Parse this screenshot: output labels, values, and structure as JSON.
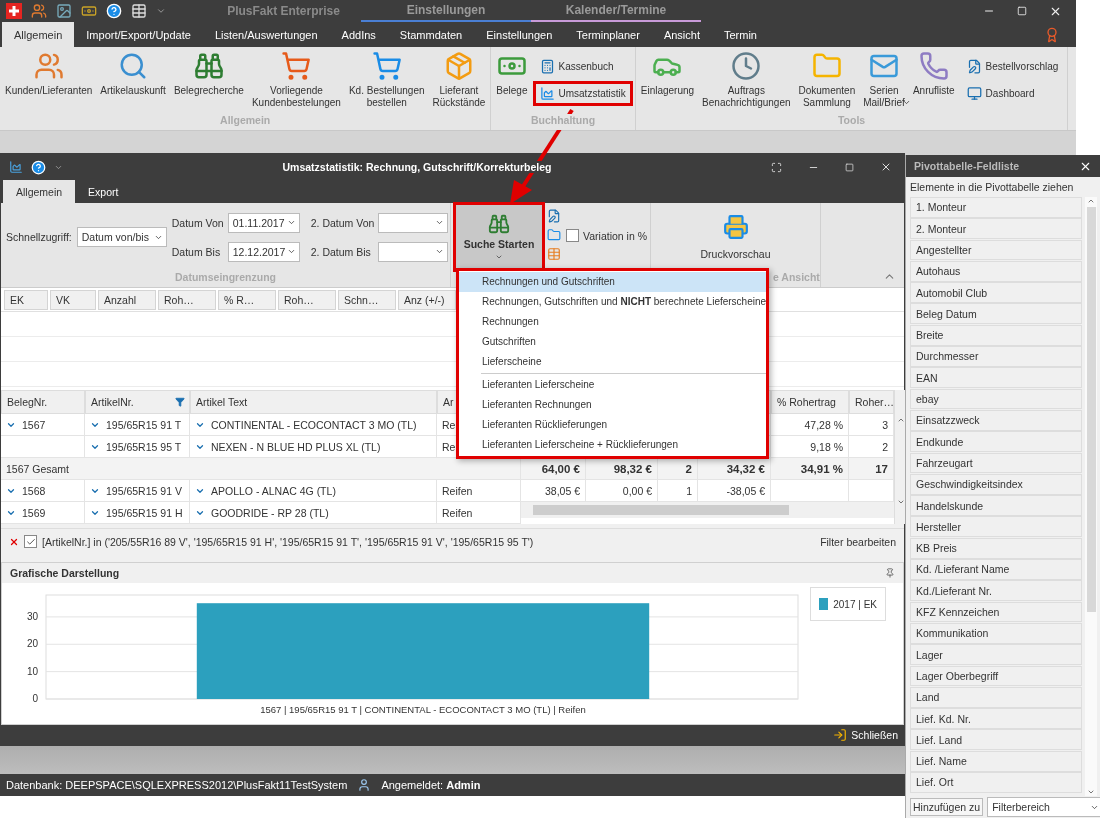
{
  "title_bar": {
    "app_title": "PlusFakt Enterprise",
    "context_tabs": [
      {
        "label": "Einstellungen",
        "color": "#4a7fd4"
      },
      {
        "label": "Kalender/Termine",
        "color": "#c89ad8"
      }
    ]
  },
  "tabs": [
    {
      "label": "Allgemein",
      "selected": true
    },
    {
      "label": "Import/Export/Update",
      "selected": false
    },
    {
      "label": "Listen/Auswertungen",
      "selected": false
    },
    {
      "label": "AddIns",
      "selected": false
    },
    {
      "label": "Stammdaten",
      "selected": false
    },
    {
      "label": "Einstellungen",
      "selected": false
    },
    {
      "label": "Terminplaner",
      "selected": false
    },
    {
      "label": "Ansicht",
      "selected": false
    },
    {
      "label": "Termin",
      "selected": false
    }
  ],
  "ribbon_groups": [
    {
      "label": "Allgemein",
      "buttons": [
        {
          "label": "Kunden/Lieferanten",
          "kind": "large",
          "highlighted": false
        },
        {
          "label": "Artikelauskunft",
          "kind": "large",
          "highlighted": false
        },
        {
          "label": "Belegrecherche",
          "kind": "large",
          "highlighted": false
        },
        {
          "label": "Vorliegende\nKundenbestelungen",
          "kind": "large",
          "highlighted": false
        },
        {
          "label": "Kd. Bestellungen\nbestellen",
          "kind": "large",
          "highlighted": false
        },
        {
          "label": "Lieferant\nRückstände",
          "kind": "large",
          "highlighted": false
        }
      ]
    },
    {
      "label": "Buchhaltung",
      "buttons": [
        {
          "label": "Belege",
          "kind": "large",
          "highlighted": false
        },
        {
          "label": "Kassenbuch",
          "kind": "small",
          "highlighted": false
        },
        {
          "label": "Umsatzstatistik",
          "kind": "small",
          "highlighted": true
        }
      ]
    },
    {
      "label": "Tools",
      "buttons": [
        {
          "label": "Einlagerung",
          "kind": "large",
          "highlighted": false
        },
        {
          "label": "Auftrags\nBenachrichtigungen",
          "kind": "large",
          "highlighted": false
        },
        {
          "label": "Dokumenten\nSammlung",
          "kind": "large",
          "highlighted": false
        },
        {
          "label": "Serien\nMail/Brief",
          "kind": "dropdown",
          "highlighted": false
        },
        {
          "label": "Anrufliste",
          "kind": "large",
          "highlighted": false
        },
        {
          "label": "Bestellvorschlag",
          "kind": "small",
          "highlighted": false
        },
        {
          "label": "Dashboard",
          "kind": "small",
          "highlighted": false
        }
      ]
    }
  ],
  "inner_window": {
    "title": "Umsatzstatistik: Rechnung, Gutschrift/Korrekturbeleg",
    "tabs": [
      {
        "label": "Allgemein",
        "selected": true
      },
      {
        "label": "Export",
        "selected": false
      }
    ],
    "quick_access": {
      "label": "Schnellzugriff:",
      "value": "Datum von/bis"
    },
    "date_fields": [
      {
        "label": "Datum Von",
        "value": "01.11.2017"
      },
      {
        "label": "Datum Bis",
        "value": "12.12.2017"
      },
      {
        "label": "2. Datum Von"
      },
      {
        "label": "2. Datum Bis"
      }
    ],
    "date_group_label": "Datumseingrenzung",
    "search_button": {
      "label": "Suche Starten",
      "highlighted": true
    },
    "variation": {
      "label": "Variation in %",
      "checked": false
    },
    "print_button": {
      "label": "Druckvorschau"
    },
    "view_group_label": "e Ansicht",
    "data_fields": [
      "EK",
      "VK",
      "Anzahl",
      "Roh…",
      "% R…",
      "Roh…",
      "Schn…",
      "Anz (+/-)"
    ],
    "row_headers": [
      "BelegNr.",
      "ArtikelNr.",
      "Artikel Text",
      "Ar"
    ],
    "value_headers": [
      "% Rohertrag",
      "Roher…"
    ],
    "rows": [
      {
        "kind": "item",
        "expanded": true,
        "cells": [
          "1567",
          "195/65R15 91 T",
          "CONTINENTAL - ECOCONTACT 3 MO (TL)",
          "Re",
          null,
          null,
          null,
          null,
          "47,28 %",
          "3"
        ]
      },
      {
        "kind": "item",
        "expanded": true,
        "cells": [
          null,
          "195/65R15 95 T",
          "NEXEN - N BLUE HD PLUS XL (TL)",
          "Re",
          null,
          null,
          null,
          null,
          "9,18 %",
          "2"
        ]
      },
      {
        "kind": "total",
        "cells": [
          "1567 Gesamt",
          null,
          null,
          null,
          "64,00 €",
          "98,32 €",
          "2",
          "34,32 €",
          "34,91 %",
          "17"
        ]
      },
      {
        "kind": "item",
        "expanded": true,
        "cells": [
          "1568",
          "195/65R15 91 V",
          "APOLLO - ALNAC 4G (TL)",
          "Reifen",
          "38,05 €",
          "0,00 €",
          "1",
          "-38,05 €",
          null,
          null
        ]
      },
      {
        "kind": "partial",
        "expanded": true,
        "cells": [
          "1569",
          "195/65R15 91 H",
          "GOODRIDE - RP 28 (TL)",
          "Reifen"
        ]
      }
    ],
    "filter": {
      "checked": true,
      "text": "[ArtikelNr.] in ('205/55R16 89 V', '195/65R15 91 H', '195/65R15 91 T', '195/65R15 91 V', '195/65R15 95 T')",
      "edit": "Filter bearbeiten"
    },
    "chart_panel": {
      "title": "Grafische Darstellung",
      "chart_data": {
        "type": "bar",
        "grid": true,
        "categories": [
          "1567 | 195/65R15 91 T | CONTINENTAL - ECOCONTACT 3 MO (TL) | Reifen"
        ],
        "series": [
          {
            "name": "2017 | EK",
            "color": "#2ca0be",
            "values": [
              35
            ]
          }
        ],
        "ylim": [
          0,
          38
        ],
        "yticks": [
          0,
          10,
          20,
          30
        ]
      }
    },
    "close_button": "Schließen"
  },
  "menu": {
    "groups": [
      [
        {
          "label": "Rechnungen und Gutschriften",
          "selected": true
        },
        {
          "label": "Rechnungen, Gutschriften und **NICHT** berechnete Lieferscheine",
          "selected": false
        },
        {
          "label": "Rechnungen",
          "selected": false
        },
        {
          "label": "Gutschriften",
          "selected": false
        },
        {
          "label": "Lieferscheine",
          "selected": false
        }
      ],
      [
        {
          "label": "Lieferanten Lieferscheine",
          "selected": false
        },
        {
          "label": "Lieferanten Rechnungen",
          "selected": false
        },
        {
          "label": "Lieferanten Rücklieferungen",
          "selected": false
        },
        {
          "label": "Lieferanten Lieferscheine + Rücklieferungen",
          "selected": false
        }
      ]
    ]
  },
  "pivot_panel": {
    "title": "Pivottabelle-Feldliste",
    "hint": "Elemente in die Pivottabelle ziehen",
    "fields": [
      "1. Monteur",
      "2. Monteur",
      "Angestellter",
      "Autohaus",
      "Automobil Club",
      "Beleg Datum",
      "Breite",
      "Durchmesser",
      "EAN",
      "ebay",
      "Einsatzzweck",
      "Endkunde",
      "Fahrzeugart",
      "Geschwindigkeitsindex",
      "Handelskunde",
      "Hersteller",
      "KB Preis",
      "Kd. /Lieferant Name",
      "Kd./Lieferant Nr.",
      "KFZ Kennzeichen",
      "Kommunikation",
      "Lager",
      "Lager Oberbegriff",
      "Land",
      "Lief. Kd. Nr.",
      "Lief. Land",
      "Lief. Name",
      "Lief. Ort"
    ],
    "add_button": "Hinzufügen zu",
    "area_select": "Filterbereich"
  },
  "status_bar": {
    "database": "Datenbank: DEEPSPACE\\SQLEXPRESS2012\\PlusFakt11TestSystem",
    "user": "Angemeldet: **Admin**"
  }
}
